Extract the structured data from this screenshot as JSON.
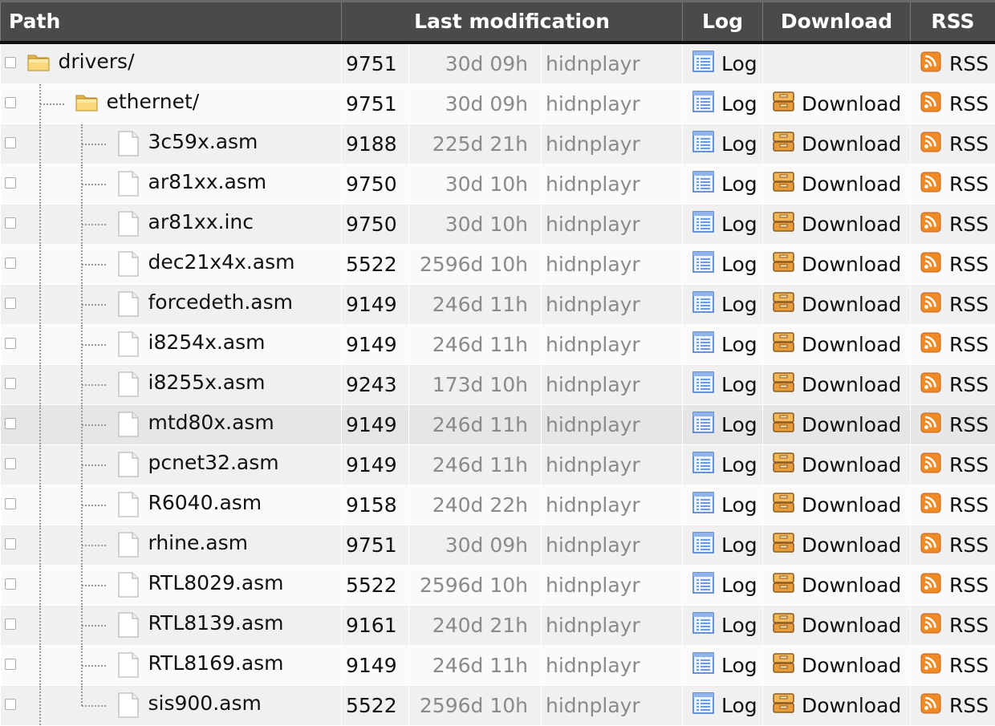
{
  "headers": {
    "path": "Path",
    "last_modification": "Last modification",
    "log": "Log",
    "download": "Download",
    "rss": "RSS"
  },
  "labels": {
    "log": "Log",
    "download": "Download",
    "rss": "RSS"
  },
  "colors": {
    "header_bg": "#4a4a4a",
    "row_odd": "#f0f0f0",
    "row_even": "#fafafa",
    "rss": "#f08a24"
  },
  "rows": [
    {
      "name": "drivers/",
      "type": "folder",
      "depth": 0,
      "rev": "9751",
      "age": "30d 09h",
      "author": "hidnplayr",
      "download": false
    },
    {
      "name": "ethernet/",
      "type": "folder",
      "depth": 1,
      "rev": "9751",
      "age": "30d 09h",
      "author": "hidnplayr",
      "download": true
    },
    {
      "name": "3c59x.asm",
      "type": "file",
      "depth": 2,
      "rev": "9188",
      "age": "225d 21h",
      "author": "hidnplayr",
      "download": true
    },
    {
      "name": "ar81xx.asm",
      "type": "file",
      "depth": 2,
      "rev": "9750",
      "age": "30d 10h",
      "author": "hidnplayr",
      "download": true
    },
    {
      "name": "ar81xx.inc",
      "type": "file",
      "depth": 2,
      "rev": "9750",
      "age": "30d 10h",
      "author": "hidnplayr",
      "download": true
    },
    {
      "name": "dec21x4x.asm",
      "type": "file",
      "depth": 2,
      "rev": "5522",
      "age": "2596d 10h",
      "author": "hidnplayr",
      "download": true
    },
    {
      "name": "forcedeth.asm",
      "type": "file",
      "depth": 2,
      "rev": "9149",
      "age": "246d 11h",
      "author": "hidnplayr",
      "download": true
    },
    {
      "name": "i8254x.asm",
      "type": "file",
      "depth": 2,
      "rev": "9149",
      "age": "246d 11h",
      "author": "hidnplayr",
      "download": true
    },
    {
      "name": "i8255x.asm",
      "type": "file",
      "depth": 2,
      "rev": "9243",
      "age": "173d 10h",
      "author": "hidnplayr",
      "download": true
    },
    {
      "name": "mtd80x.asm",
      "type": "file",
      "depth": 2,
      "rev": "9149",
      "age": "246d 11h",
      "author": "hidnplayr",
      "download": true,
      "highlight": true
    },
    {
      "name": "pcnet32.asm",
      "type": "file",
      "depth": 2,
      "rev": "9149",
      "age": "246d 11h",
      "author": "hidnplayr",
      "download": true
    },
    {
      "name": "R6040.asm",
      "type": "file",
      "depth": 2,
      "rev": "9158",
      "age": "240d 22h",
      "author": "hidnplayr",
      "download": true
    },
    {
      "name": "rhine.asm",
      "type": "file",
      "depth": 2,
      "rev": "9751",
      "age": "30d 09h",
      "author": "hidnplayr",
      "download": true
    },
    {
      "name": "RTL8029.asm",
      "type": "file",
      "depth": 2,
      "rev": "5522",
      "age": "2596d 10h",
      "author": "hidnplayr",
      "download": true
    },
    {
      "name": "RTL8139.asm",
      "type": "file",
      "depth": 2,
      "rev": "9161",
      "age": "240d 21h",
      "author": "hidnplayr",
      "download": true
    },
    {
      "name": "RTL8169.asm",
      "type": "file",
      "depth": 2,
      "rev": "9149",
      "age": "246d 11h",
      "author": "hidnplayr",
      "download": true
    },
    {
      "name": "sis900.asm",
      "type": "file",
      "depth": 2,
      "rev": "5522",
      "age": "2596d 10h",
      "author": "hidnplayr",
      "download": true
    }
  ]
}
